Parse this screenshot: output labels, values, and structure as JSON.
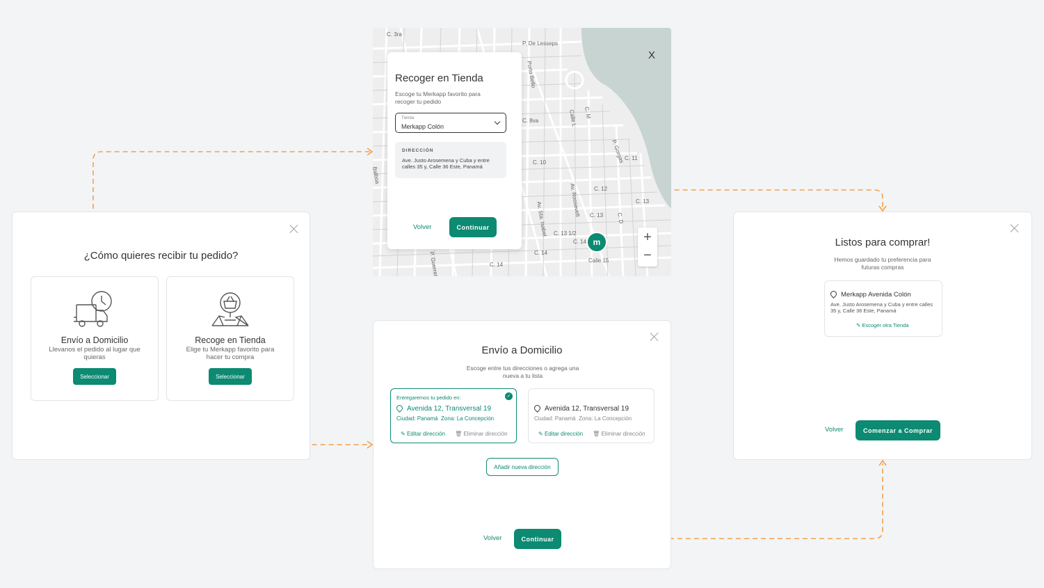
{
  "colors": {
    "accent": "#0c8a72",
    "arrow": "#f5a04a",
    "bg": "#f3f4f6"
  },
  "delivery_choice": {
    "title": "¿Cómo quieres recibir tu pedido?",
    "options": [
      {
        "icon": "delivery-truck-clock-icon",
        "title": "Envío a Domicilio",
        "desc": "Llevanos el pedido al lugar que quieras",
        "button": "Seleccionar"
      },
      {
        "icon": "store-map-basket-icon",
        "title": "Recoge en Tienda",
        "desc": "Elige tu Merkapp favorito para hacer tu compra",
        "button": "Seleccionar"
      }
    ]
  },
  "pickup": {
    "title": "Recoger en Tienda",
    "subtitle": "Escoge tu Merkapp favorito para recoger tu pedido",
    "store_field_label": "Tienda",
    "store_value": "Merkapp Colón",
    "address_label": "DIRECCIÓN",
    "address": "Ave. Justo Arosemena y Cuba y entre calles 35 y, Calle 36 Este, Panamá",
    "back": "Volver",
    "continue": "Continuar",
    "map_close": "X",
    "zoom_in": "+",
    "zoom_out": "−",
    "streets": [
      "C. 3ra",
      "P. De Lesseps",
      "Porto Bello",
      "Calle L",
      "C. M",
      "C. 8va",
      "P. Gorgas",
      "C. 11",
      "C. 10",
      "C. 12",
      "C. 13",
      "Av. Roosevelt",
      "Av. Sta. Isabel",
      "C. 13 1/2",
      "C. 14",
      "Calle 15",
      "C. D",
      "C. 13",
      "C. 14",
      "C. 14",
      "P. Guerrero",
      "Balboa"
    ]
  },
  "home_delivery": {
    "title": "Envío a Domicilio",
    "subtitle": "Escoge entre tus direcciones o agrega una nueva a tu lista",
    "selected_caption": "Entregaremos tu pedido en:",
    "addresses": [
      {
        "street": "Avenida 12, Transversal 19",
        "city": "Ciudad: Panamá",
        "zone": "Zona: La Concepción",
        "edit": "Editar dirección",
        "delete": "Eliminar dirección"
      },
      {
        "street": "Avenida 12, Transversal 19",
        "city": "Ciudad: Panamá",
        "zone": "Zona: La Concepción",
        "edit": "Editar dirección",
        "delete": "Eliminar dirección"
      }
    ],
    "add_button": "Añadir nueva dirección",
    "back": "Volver",
    "continue": "Continuar"
  },
  "ready": {
    "title": "Listos para comprar!",
    "subtitle": "Hemos guardado tu preferencia para futuras compras",
    "store_name": "Merkapp Avenida Colón",
    "store_address": "Ave. Justo Arosemena y Cuba y entre calles 35 y, Calle 36 Este, Panamá",
    "change_store": "Escoger otra Tienda",
    "back": "Volver",
    "start": "Comenzar a Comprar"
  }
}
